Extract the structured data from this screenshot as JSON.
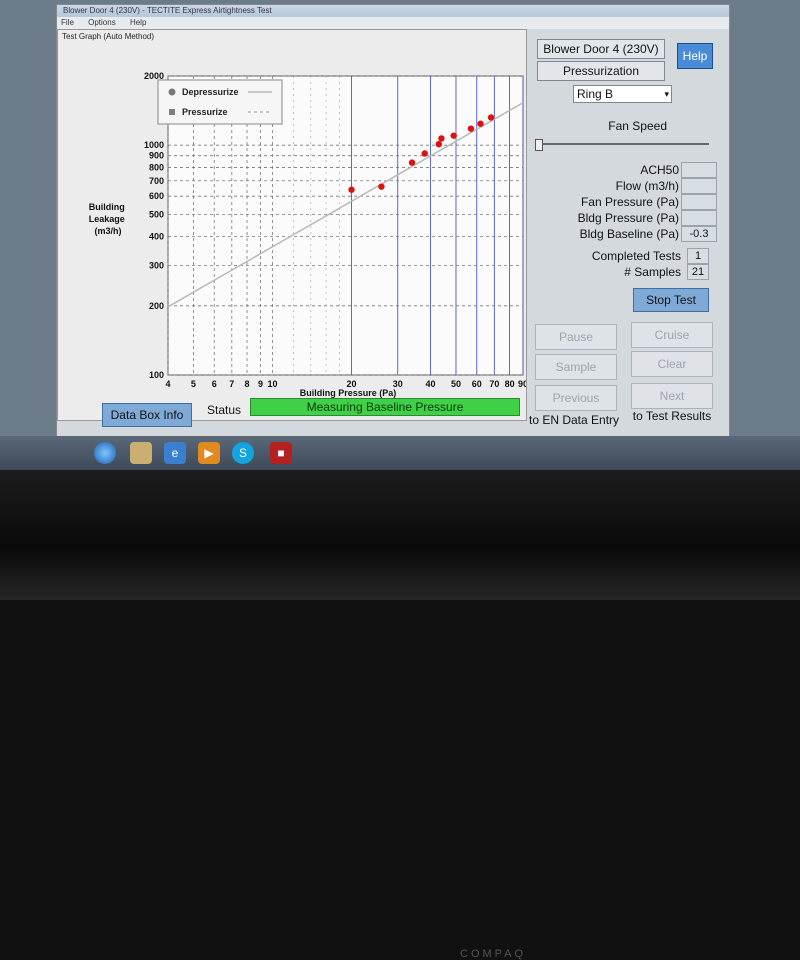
{
  "window": {
    "title": "Blower Door 4 (230V) - TECTITE Express Airtightness Test",
    "menu": [
      "File",
      "Options",
      "Help"
    ]
  },
  "graph_panel": {
    "title": "Test Graph (Auto Method)"
  },
  "chart_data": {
    "type": "scatter",
    "xlabel": "Building Pressure (Pa)",
    "ylabel": "Building Leakage (m3/h)",
    "x_scale": "log",
    "y_scale": "log",
    "xlim": [
      4,
      90
    ],
    "ylim": [
      100,
      2000
    ],
    "x_ticks": [
      4,
      5,
      6,
      7,
      8,
      9,
      10,
      20,
      30,
      40,
      50,
      60,
      70,
      80,
      90
    ],
    "y_ticks": [
      100,
      200,
      300,
      400,
      500,
      600,
      700,
      800,
      900,
      1000,
      2000
    ],
    "legend": {
      "position": "top-left",
      "entries": [
        "Depressurize",
        "Pressurize"
      ]
    },
    "series": [
      {
        "name": "Pressurize",
        "points": [
          {
            "x": 20,
            "y": 640
          },
          {
            "x": 26,
            "y": 660
          },
          {
            "x": 34,
            "y": 840
          },
          {
            "x": 38,
            "y": 920
          },
          {
            "x": 43,
            "y": 1010
          },
          {
            "x": 44,
            "y": 1070
          },
          {
            "x": 49,
            "y": 1100
          },
          {
            "x": 57,
            "y": 1180
          },
          {
            "x": 62,
            "y": 1240
          },
          {
            "x": 68,
            "y": 1320
          }
        ]
      }
    ],
    "fit_line": [
      {
        "x": 4,
        "y": 198
      },
      {
        "x": 90,
        "y": 1530
      }
    ],
    "grid": true,
    "colors": {
      "points": "#e01010",
      "fit": "#b8b8b8",
      "grid_blue": "#4a57c8",
      "grid_dash": "#777777"
    }
  },
  "right_panel": {
    "device": "Blower Door 4 (230V)",
    "mode": "Pressurization",
    "ring": "Ring B",
    "fan_speed_label": "Fan Speed",
    "help_label": "Help",
    "readouts": [
      {
        "label": "ACH50",
        "value": ""
      },
      {
        "label": "Flow (m3/h)",
        "value": ""
      },
      {
        "label": "Fan Pressure (Pa)",
        "value": ""
      },
      {
        "label": "Bldg Pressure (Pa)",
        "value": ""
      },
      {
        "label": "Bldg Baseline (Pa)",
        "value": "-0.3"
      }
    ],
    "completed_tests_label": "Completed Tests",
    "completed_tests": "1",
    "samples_label": "# Samples",
    "samples": "21",
    "stop_test": "Stop Test",
    "pause": "Pause",
    "cruise": "Cruise",
    "sample": "Sample",
    "clear": "Clear",
    "previous": "Previous",
    "next": "Next",
    "to_en": "to EN Data Entry",
    "to_results": "to Test Results"
  },
  "status": {
    "label": "Status",
    "text": "Measuring Baseline Pressure",
    "color": "#3fd047"
  },
  "data_box_button": "Data Box Info",
  "taskbar": {
    "icons": [
      "start-orb-icon",
      "folder-icon",
      "ie-icon",
      "media-player-icon",
      "skype-icon",
      "app-icon"
    ]
  },
  "bezel_brand": "COMPAQ"
}
